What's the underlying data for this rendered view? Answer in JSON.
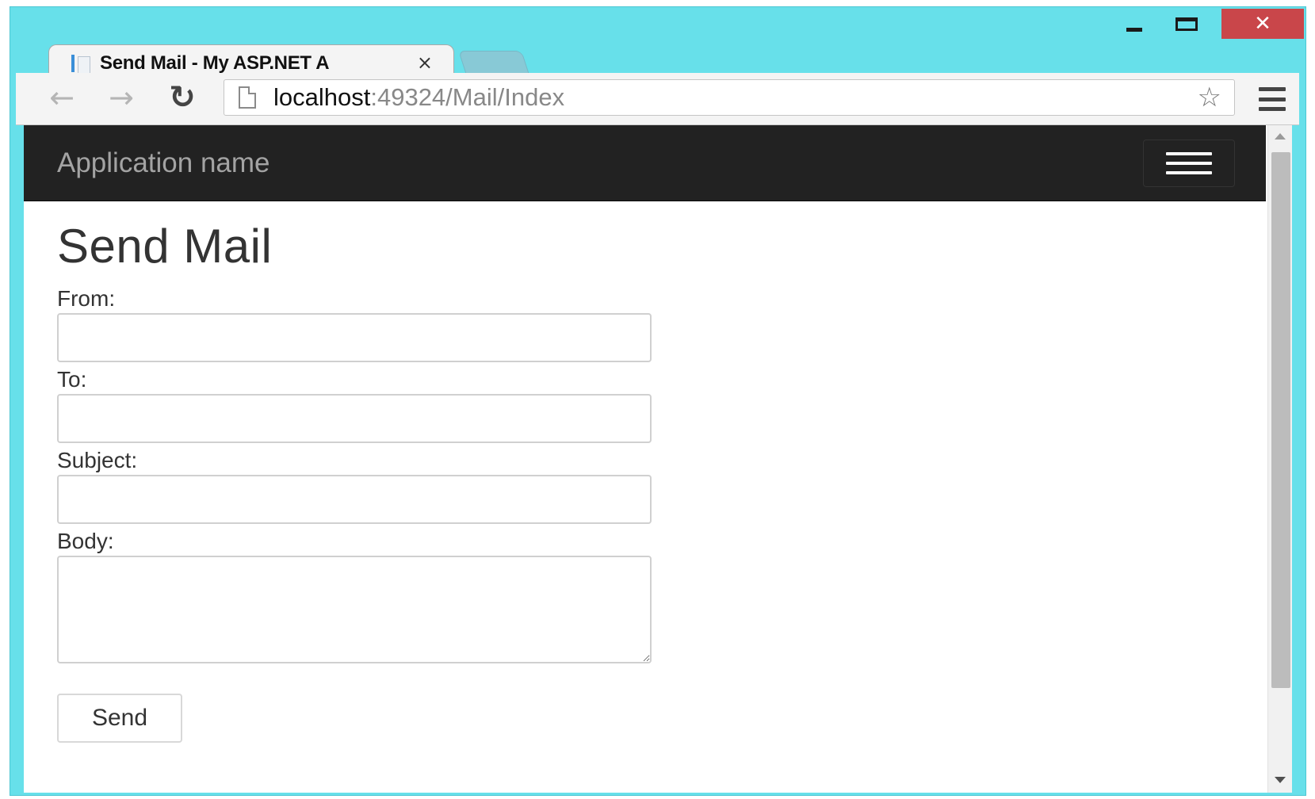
{
  "browser": {
    "tab": {
      "title": "Send Mail - My ASP.NET A",
      "close_icon": "×"
    },
    "window_controls": {
      "close_glyph": "✕"
    },
    "nav": {
      "back_icon": "←",
      "forward_icon": "→",
      "reload_icon": "↻",
      "star_icon": "☆"
    },
    "address": {
      "host": "localhost",
      "path": ":49324/Mail/Index"
    }
  },
  "navbar": {
    "brand": "Application name"
  },
  "form": {
    "title": "Send Mail",
    "from_label": "From:",
    "from_value": "",
    "to_label": "To:",
    "to_value": "",
    "subject_label": "Subject:",
    "subject_value": "",
    "body_label": "Body:",
    "body_value": "",
    "send_label": "Send"
  },
  "colors": {
    "window_frame": "#67e0ea",
    "navbar_bg": "#222222",
    "close_button": "#c9464a"
  }
}
